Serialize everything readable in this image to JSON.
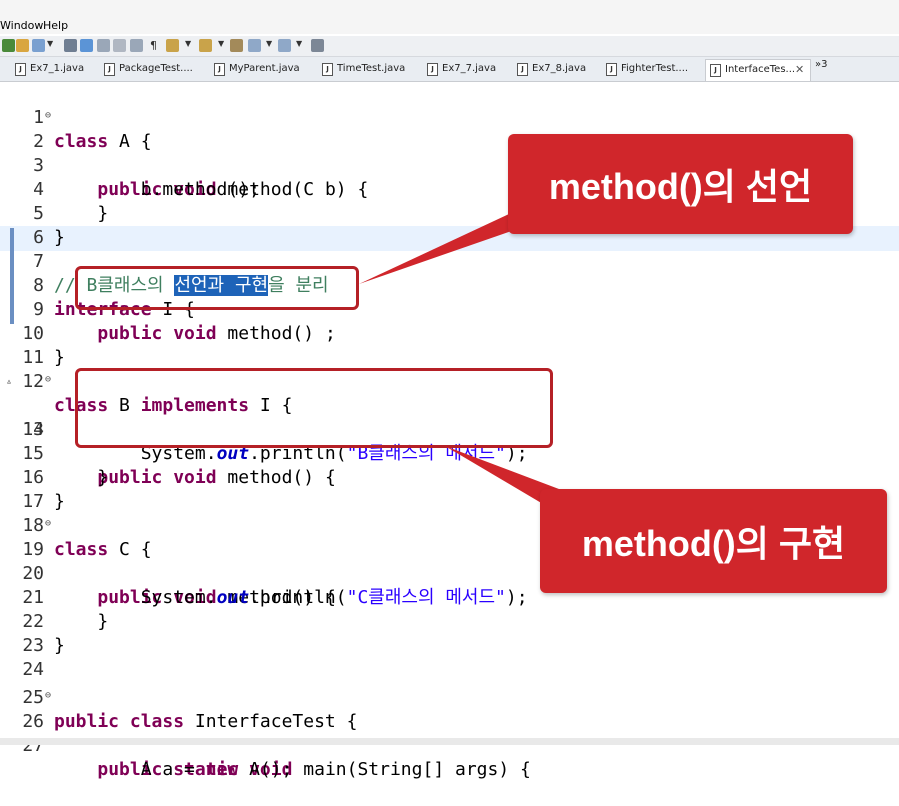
{
  "menu": {
    "window": "Window",
    "help": "Help"
  },
  "tabs": [
    {
      "label": "Ex7_1.java",
      "active": false
    },
    {
      "label": "PackageTest....",
      "active": false
    },
    {
      "label": "MyParent.java",
      "active": false
    },
    {
      "label": "TimeTest.java",
      "active": false
    },
    {
      "label": "Ex7_7.java",
      "active": false
    },
    {
      "label": "Ex7_8.java",
      "active": false
    },
    {
      "label": "FighterTest....",
      "active": false
    },
    {
      "label": "InterfaceTes...",
      "active": true
    }
  ],
  "tab_close": "✕",
  "tab_overflow": "»3",
  "file_icon": "J",
  "code": {
    "line_numbers": [
      "1",
      "2",
      "3",
      "4",
      "5",
      "6",
      "7",
      "8",
      "9",
      "10",
      "11",
      "12",
      "13",
      "14",
      "15",
      "16",
      "17",
      "18",
      "19",
      "20",
      "21",
      "22",
      "23",
      "24",
      "25",
      "26",
      "27"
    ],
    "l1_class": "class",
    "l1_rest": " A {",
    "l2_mod": "public void",
    "l2_rest": " method(C b) {",
    "l3": "b.method();",
    "l4": "}",
    "l5": "}",
    "l7_a": "// B클래스의 ",
    "l7_sel": "선언과 구현",
    "l7_b": "을 분리",
    "l8_kw": "interface",
    "l8_rest": " I {",
    "l9_mod": "public void",
    "l9_rest": " method() ;",
    "l10": "}",
    "l12_class": "class",
    "l12_mid": " B ",
    "l12_impl": "implements",
    "l12_rest": " I {",
    "l13_mod": "public void",
    "l13_rest": " method() {",
    "l14_a": "System.",
    "l14_out": "out",
    "l14_b": ".println(",
    "l14_str": "\"B클래스의 메서드\"",
    "l14_c": ");",
    "l15": "}",
    "l16": "}",
    "l18_class": "class",
    "l18_rest": " C {",
    "l19_mod": "public void",
    "l19_rest": " method() {",
    "l20_a": "System.",
    "l20_out": "out",
    "l20_b": ".println(",
    "l20_str": "\"C클래스의 메서드\"",
    "l20_c": ");",
    "l21": "}",
    "l22": "}",
    "l25_kw": "public class",
    "l25_rest": " InterfaceTest {",
    "l26_mod": "public static void",
    "l26_rest": " main(String[] args) {",
    "l27_a": "A a = ",
    "l27_new": "new",
    "l27_b": " A();"
  },
  "callouts": {
    "declaration": "method()의 선언",
    "implementation": "method()의 구현"
  },
  "colors": {
    "keyword": "#7f0055",
    "comment": "#3f7f5f",
    "string": "#2a00ff",
    "field": "#0000c0",
    "selection": "#1e63b8",
    "callout_red": "#d0262b"
  }
}
